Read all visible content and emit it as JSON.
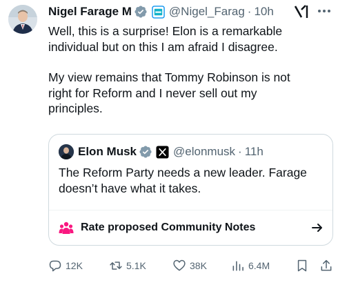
{
  "author": {
    "name": "Nigel Farage M",
    "handle": "@Nigel_Farag",
    "time": "10h"
  },
  "post": {
    "paragraphs": [
      "Well, this is a surprise! Elon is a remarkable\nindividual but on this I am afraid I disagree.",
      "My view remains that Tommy Robinson is not\nright for Reform and I never sell out my\nprinciples."
    ]
  },
  "quote": {
    "name": "Elon Musk",
    "handle": "@elonmusk",
    "time": "11h",
    "text": "The Reform Party needs a new leader. Farage\ndoesn’t have what it takes.",
    "notes_label": "Rate proposed Community Notes"
  },
  "actions": {
    "replies": "12K",
    "retweets": "5.1K",
    "likes": "38K",
    "views": "6.4M"
  },
  "separator": "·",
  "colors": {
    "verified": "#829aab",
    "muted": "#536471",
    "notes_pink": "#f91880",
    "border": "#cfd9de"
  },
  "icons": [
    "verified-badge-icon",
    "affiliation-badge-icon",
    "grok-icon",
    "more-icon",
    "x-badge-icon",
    "community-notes-icon",
    "arrow-right-icon",
    "reply-icon",
    "retweet-icon",
    "like-icon",
    "views-icon",
    "bookmark-icon",
    "share-icon"
  ]
}
